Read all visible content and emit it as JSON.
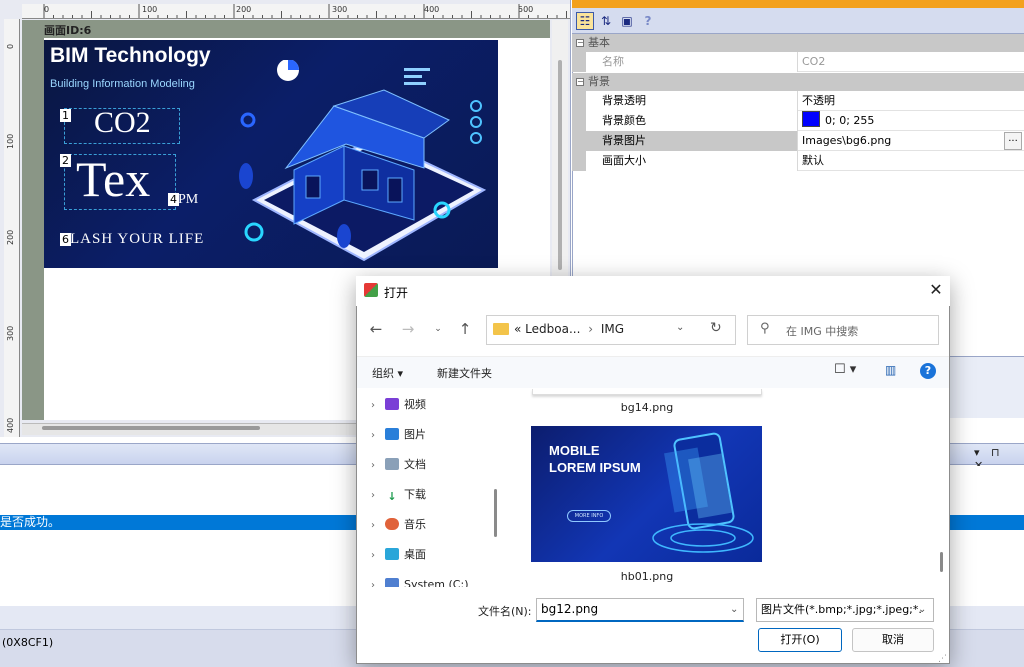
{
  "designer": {
    "screen_id": "画面ID:6",
    "ruler_top_labels": [
      "0",
      "100",
      "200",
      "300",
      "400",
      "500"
    ],
    "ruler_left_labels": [
      "0",
      "100",
      "200",
      "300",
      "400"
    ],
    "bim_title": "BIM Technology",
    "bim_subtitle": "Building Information Modeling",
    "elements": [
      {
        "tag": "1",
        "text": "CO2"
      },
      {
        "tag": "2",
        "text": "Tex"
      },
      {
        "tag": "4",
        "text": "PM"
      },
      {
        "tag": "6",
        "text": "LASH YOUR LIFE"
      }
    ]
  },
  "properties": {
    "toolbar_help": "?",
    "categories": [
      {
        "name": "基本",
        "rows": [
          {
            "label": "名称",
            "value": "CO2",
            "disabled": true
          }
        ]
      },
      {
        "name": "背景",
        "rows": [
          {
            "label": "背景透明",
            "value": "不透明"
          },
          {
            "label": "背景颜色",
            "value": "0; 0; 255",
            "swatch": "#0000ff"
          },
          {
            "label": "背景图片",
            "value": "Images\\bg6.png",
            "button": "..."
          },
          {
            "label": "画面大小",
            "value": "默认"
          }
        ]
      }
    ]
  },
  "output": {
    "line": "是否成功。",
    "pin_close": "▾ ⊓ ✕",
    "status": "(0X8CF1)"
  },
  "dialog": {
    "title": "打开",
    "close": "✕",
    "address": {
      "prefix": "«",
      "segment1": "Ledboa...",
      "separator": "›",
      "segment2": "IMG"
    },
    "search_placeholder": "在 IMG 中搜索",
    "organize": "组织 ▾",
    "new_folder": "新建文件夹",
    "tree": [
      {
        "label": "视频",
        "icon_color": "#7a3fd6"
      },
      {
        "label": "图片",
        "icon_color": "#2a7fd9"
      },
      {
        "label": "文档",
        "icon_color": "#8aa0b8"
      },
      {
        "label": "下载",
        "icon_color": "#1e9b4f"
      },
      {
        "label": "音乐",
        "icon_color": "#e0623a"
      },
      {
        "label": "桌面",
        "icon_color": "#2aa6d9"
      },
      {
        "label": "System (C:)",
        "icon_color": "#4f7fd0"
      }
    ],
    "files": [
      {
        "name": "bg14.png"
      },
      {
        "name": "hb01.png",
        "thumb_title_1": "MOBILE",
        "thumb_title_2": "LOREM IPSUM",
        "thumb_button": "MORE INFO"
      }
    ],
    "filename_label": "文件名(N):",
    "filename_value": "bg12.png",
    "filetype_value": "图片文件(*.bmp;*.jpg;*.jpeg;*.",
    "open_button": "打开(O)",
    "cancel_button": "取消"
  },
  "colors": {
    "accent": "#0078d7",
    "props_orange": "#f3a11d",
    "swatch_blue": "#0000ff"
  }
}
